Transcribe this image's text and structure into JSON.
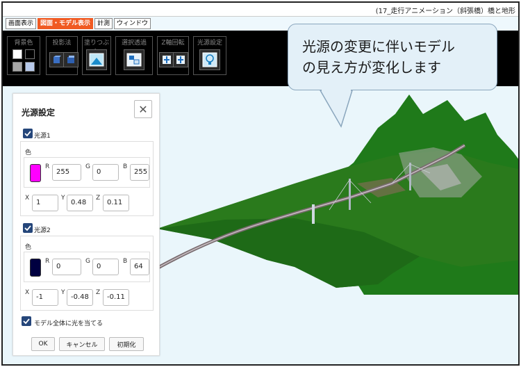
{
  "window": {
    "title": "(17_走行アニメーション（斜張橋）橋と地形"
  },
  "menu": {
    "tabs": [
      {
        "label": "画面表示"
      },
      {
        "label": "図面・モデル表示"
      },
      {
        "label": "計測"
      },
      {
        "label": "ウィンドウ"
      }
    ]
  },
  "toolbar": {
    "groups": [
      {
        "label": "背景色"
      },
      {
        "label": "投影法"
      },
      {
        "label": "塗りつぶし"
      },
      {
        "label": "選択透過"
      },
      {
        "label": "Z軸回転"
      },
      {
        "label": "光源設定"
      }
    ]
  },
  "callout": {
    "line1": "光源の変更に伴いモデル",
    "line2": "の見え方が変化します"
  },
  "dialog": {
    "title": "光源設定",
    "close_glyph": "✕",
    "light1": {
      "label": "光源1",
      "color_label": "色",
      "color": "#ff00ff",
      "r_label": "R",
      "g_label": "G",
      "b_label": "B",
      "r": "255",
      "g": "0",
      "b": "255",
      "x_label": "X",
      "y_label": "Y",
      "z_label": "Z",
      "x": "1",
      "y": "0.48",
      "z": "0.11"
    },
    "light2": {
      "label": "光源2",
      "color_label": "色",
      "color": "#000040",
      "r_label": "R",
      "g_label": "G",
      "b_label": "B",
      "r": "0",
      "g": "0",
      "b": "64",
      "x_label": "X",
      "y_label": "Y",
      "z_label": "Z",
      "x": "-1",
      "y": "-0.48",
      "z": "-0.11"
    },
    "apply_all_label": "モデル全体に光を当てる",
    "ok_label": "OK",
    "cancel_label": "キャンセル",
    "reset_label": "初期化"
  }
}
